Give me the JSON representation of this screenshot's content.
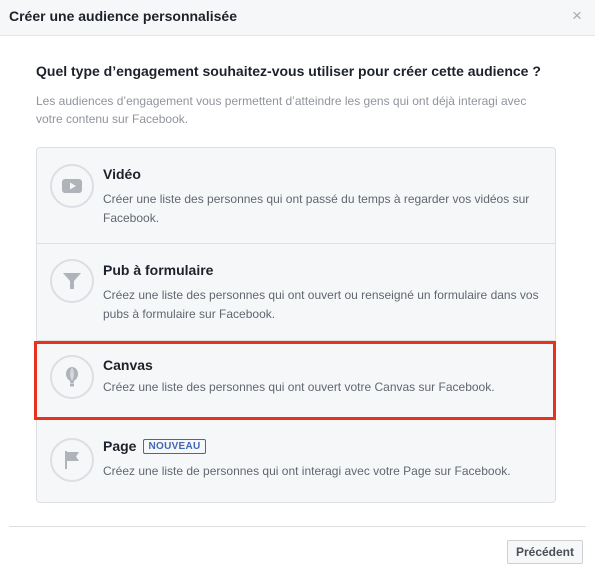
{
  "dialog": {
    "title": "Créer une audience personnalisée",
    "close_glyph": "×"
  },
  "question": "Quel type d’engagement souhaitez-vous utiliser pour créer cette audience ?",
  "description": "Les audiences d’engagement vous permettent d’atteindre les gens qui ont déjà interagi avec votre contenu sur Facebook.",
  "options": [
    {
      "title": "Vidéo",
      "description": "Créer une liste des personnes qui ont passé du temps à regarder vos vidéos sur Facebook.",
      "icon": "video-icon"
    },
    {
      "title": "Pub à formulaire",
      "description": "Créez une liste des personnes qui ont ouvert ou renseigné un formulaire dans vos pubs à formulaire sur Facebook.",
      "icon": "funnel-icon"
    },
    {
      "title": "Canvas",
      "description": "Créez une liste des personnes qui ont ouvert votre Canvas sur Facebook.",
      "icon": "balloon-icon",
      "highlighted": true
    },
    {
      "title": "Page",
      "badge": "NOUVEAU",
      "description": "Créez une liste de personnes qui ont interagi avec votre Page sur Facebook.",
      "icon": "flag-icon"
    }
  ],
  "footer": {
    "previous_label": "Précédent"
  },
  "colors": {
    "highlight": "#e8321d",
    "badge": "#4267b2",
    "icon_gray": "#b0b3b9"
  }
}
